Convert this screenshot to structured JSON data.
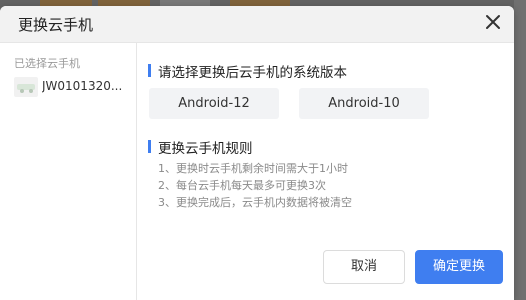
{
  "dialog": {
    "title": "更换云手机",
    "close_icon": "close-icon"
  },
  "sidebar": {
    "label": "已选择云手机",
    "devices": [
      {
        "name": "JW0101320...",
        "icon": "phone-thumbnail"
      }
    ]
  },
  "version_section": {
    "title": "请选择更换后云手机的系统版本",
    "options": [
      {
        "label": "Android-12"
      },
      {
        "label": "Android-10"
      }
    ]
  },
  "rules_section": {
    "title": "更换云手机规则",
    "rules": [
      "1、更换时云手机剩余时间需大于1小时",
      "2、每台云手机每天最多可更换3次",
      "3、更换完成后，云手机内数据将被清空"
    ]
  },
  "footer": {
    "cancel_label": "取消",
    "confirm_label": "确定更换"
  },
  "colors": {
    "accent": "#3f7ef0",
    "header_bg": "#f2f2f2",
    "option_bg": "#f2f3f5"
  }
}
